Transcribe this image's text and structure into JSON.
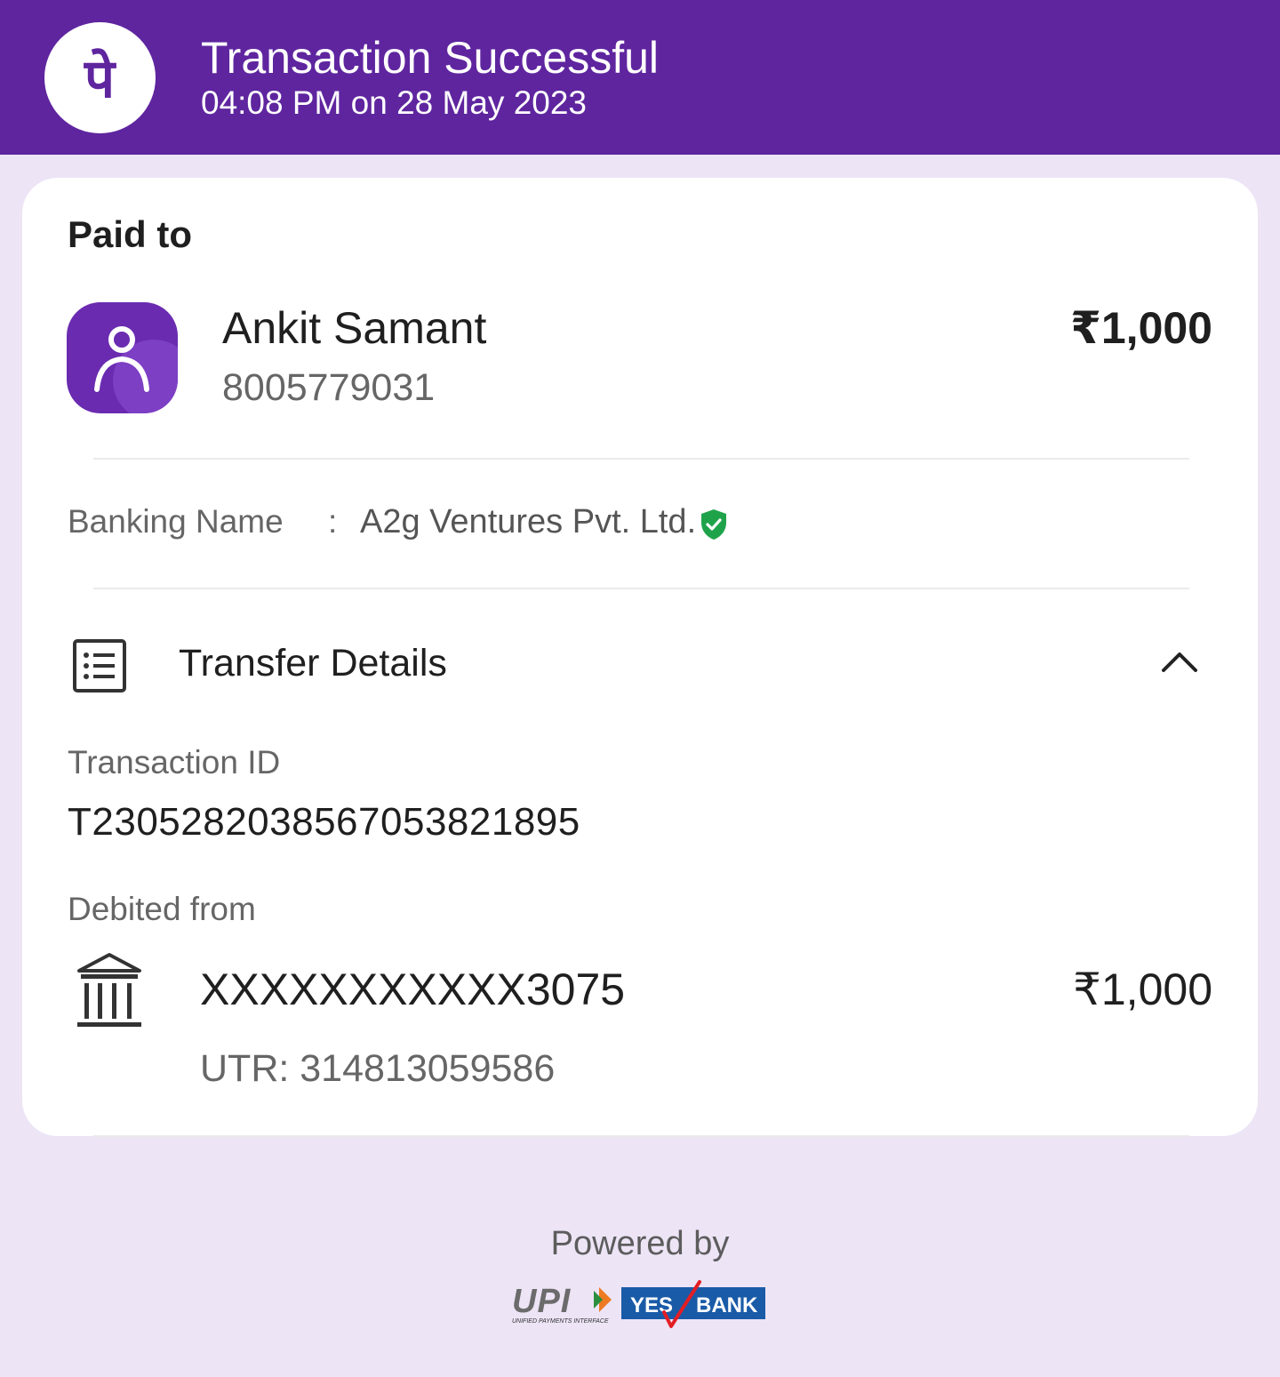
{
  "header": {
    "title": "Transaction Successful",
    "timestamp": "04:08 PM on 28 May 2023",
    "logo_glyph": "पे",
    "brand_color": "#5F259F"
  },
  "paid_to": {
    "label": "Paid to",
    "name": "Ankit Samant",
    "phone": "8005779031",
    "amount": "₹1,000"
  },
  "banking": {
    "label": "Banking Name",
    "separator": ":",
    "value": "A2g Ventures Pvt. Ltd.",
    "verified_icon": "shield-check-icon",
    "verified_color": "#1FA34A"
  },
  "transfer_details": {
    "title": "Transfer Details",
    "icon": "list-icon",
    "toggle_icon": "chevron-up-icon",
    "transaction_id_label": "Transaction ID",
    "transaction_id": "T2305282038567053821895",
    "debited_from_label": "Debited from",
    "account": "XXXXXXXXXXX3075",
    "amount": "₹1,000",
    "utr": "UTR: 314813059586"
  },
  "footer": {
    "powered_by": "Powered by",
    "upi_text": "UPI",
    "upi_subtext": "UNIFIED PAYMENTS INTERFACE",
    "bank_left": "YES",
    "bank_right": "BANK"
  }
}
